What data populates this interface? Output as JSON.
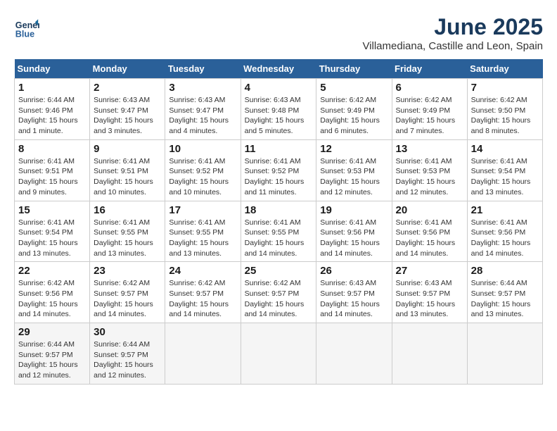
{
  "header": {
    "logo_line1": "General",
    "logo_line2": "Blue",
    "month_title": "June 2025",
    "location": "Villamediana, Castille and Leon, Spain"
  },
  "days_of_week": [
    "Sunday",
    "Monday",
    "Tuesday",
    "Wednesday",
    "Thursday",
    "Friday",
    "Saturday"
  ],
  "weeks": [
    [
      {
        "day": "1",
        "sunrise": "6:44 AM",
        "sunset": "9:46 PM",
        "daylight": "15 hours and 1 minute."
      },
      {
        "day": "2",
        "sunrise": "6:43 AM",
        "sunset": "9:47 PM",
        "daylight": "15 hours and 3 minutes."
      },
      {
        "day": "3",
        "sunrise": "6:43 AM",
        "sunset": "9:47 PM",
        "daylight": "15 hours and 4 minutes."
      },
      {
        "day": "4",
        "sunrise": "6:43 AM",
        "sunset": "9:48 PM",
        "daylight": "15 hours and 5 minutes."
      },
      {
        "day": "5",
        "sunrise": "6:42 AM",
        "sunset": "9:49 PM",
        "daylight": "15 hours and 6 minutes."
      },
      {
        "day": "6",
        "sunrise": "6:42 AM",
        "sunset": "9:49 PM",
        "daylight": "15 hours and 7 minutes."
      },
      {
        "day": "7",
        "sunrise": "6:42 AM",
        "sunset": "9:50 PM",
        "daylight": "15 hours and 8 minutes."
      }
    ],
    [
      {
        "day": "8",
        "sunrise": "6:41 AM",
        "sunset": "9:51 PM",
        "daylight": "15 hours and 9 minutes."
      },
      {
        "day": "9",
        "sunrise": "6:41 AM",
        "sunset": "9:51 PM",
        "daylight": "15 hours and 10 minutes."
      },
      {
        "day": "10",
        "sunrise": "6:41 AM",
        "sunset": "9:52 PM",
        "daylight": "15 hours and 10 minutes."
      },
      {
        "day": "11",
        "sunrise": "6:41 AM",
        "sunset": "9:52 PM",
        "daylight": "15 hours and 11 minutes."
      },
      {
        "day": "12",
        "sunrise": "6:41 AM",
        "sunset": "9:53 PM",
        "daylight": "15 hours and 12 minutes."
      },
      {
        "day": "13",
        "sunrise": "6:41 AM",
        "sunset": "9:53 PM",
        "daylight": "15 hours and 12 minutes."
      },
      {
        "day": "14",
        "sunrise": "6:41 AM",
        "sunset": "9:54 PM",
        "daylight": "15 hours and 13 minutes."
      }
    ],
    [
      {
        "day": "15",
        "sunrise": "6:41 AM",
        "sunset": "9:54 PM",
        "daylight": "15 hours and 13 minutes."
      },
      {
        "day": "16",
        "sunrise": "6:41 AM",
        "sunset": "9:55 PM",
        "daylight": "15 hours and 13 minutes."
      },
      {
        "day": "17",
        "sunrise": "6:41 AM",
        "sunset": "9:55 PM",
        "daylight": "15 hours and 13 minutes."
      },
      {
        "day": "18",
        "sunrise": "6:41 AM",
        "sunset": "9:55 PM",
        "daylight": "15 hours and 14 minutes."
      },
      {
        "day": "19",
        "sunrise": "6:41 AM",
        "sunset": "9:56 PM",
        "daylight": "15 hours and 14 minutes."
      },
      {
        "day": "20",
        "sunrise": "6:41 AM",
        "sunset": "9:56 PM",
        "daylight": "15 hours and 14 minutes."
      },
      {
        "day": "21",
        "sunrise": "6:41 AM",
        "sunset": "9:56 PM",
        "daylight": "15 hours and 14 minutes."
      }
    ],
    [
      {
        "day": "22",
        "sunrise": "6:42 AM",
        "sunset": "9:56 PM",
        "daylight": "15 hours and 14 minutes."
      },
      {
        "day": "23",
        "sunrise": "6:42 AM",
        "sunset": "9:57 PM",
        "daylight": "15 hours and 14 minutes."
      },
      {
        "day": "24",
        "sunrise": "6:42 AM",
        "sunset": "9:57 PM",
        "daylight": "15 hours and 14 minutes."
      },
      {
        "day": "25",
        "sunrise": "6:42 AM",
        "sunset": "9:57 PM",
        "daylight": "15 hours and 14 minutes."
      },
      {
        "day": "26",
        "sunrise": "6:43 AM",
        "sunset": "9:57 PM",
        "daylight": "15 hours and 14 minutes."
      },
      {
        "day": "27",
        "sunrise": "6:43 AM",
        "sunset": "9:57 PM",
        "daylight": "15 hours and 13 minutes."
      },
      {
        "day": "28",
        "sunrise": "6:44 AM",
        "sunset": "9:57 PM",
        "daylight": "15 hours and 13 minutes."
      }
    ],
    [
      {
        "day": "29",
        "sunrise": "6:44 AM",
        "sunset": "9:57 PM",
        "daylight": "15 hours and 12 minutes."
      },
      {
        "day": "30",
        "sunrise": "6:44 AM",
        "sunset": "9:57 PM",
        "daylight": "15 hours and 12 minutes."
      },
      null,
      null,
      null,
      null,
      null
    ]
  ],
  "labels": {
    "sunrise": "Sunrise:",
    "sunset": "Sunset:",
    "daylight": "Daylight hours"
  }
}
